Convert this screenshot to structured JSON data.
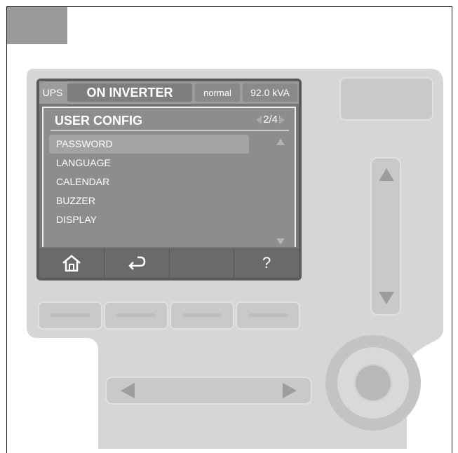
{
  "topbar": {
    "ups_label": "UPS",
    "status": "ON INVERTER",
    "mode": "normal",
    "power": "92.0 kVA"
  },
  "menu": {
    "title": "USER CONFIG",
    "page_indicator": "2/4",
    "items": [
      "PASSWORD",
      "LANGUAGE",
      "CALENDAR",
      "BUZZER",
      "DISPLAY"
    ],
    "selected_index": 0
  },
  "softkeys": {
    "home_icon": "home-icon",
    "back_icon": "return-arrow-icon",
    "third": "",
    "help": "?"
  },
  "colors": {
    "screen_bg": "#777777",
    "panel_bg": "#d6d6d6",
    "button": "#c9c9c9"
  }
}
